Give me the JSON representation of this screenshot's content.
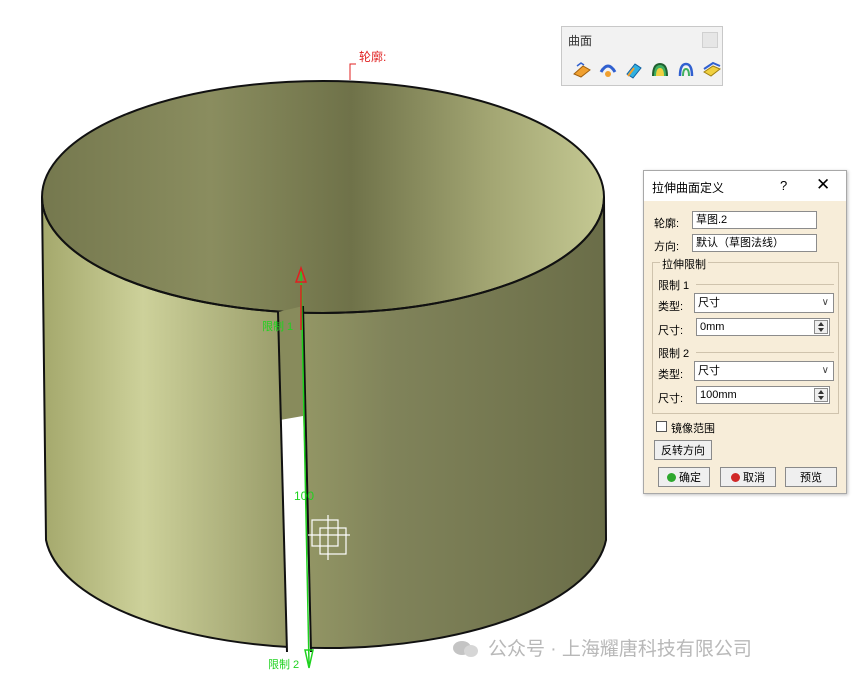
{
  "viewport": {
    "profile_label": "轮廓:",
    "limit1_label": "限制 1",
    "limit2_label": "限制 2",
    "dimension_label": "100"
  },
  "toolbar": {
    "title": "曲面",
    "icons": [
      "extrude-surface-icon",
      "revolve-surface-icon",
      "sphere-surface-icon",
      "cylinder-surface-icon",
      "offset-surface-icon",
      "fill-surface-icon"
    ]
  },
  "dialog": {
    "title": "拉伸曲面定义",
    "help": "?",
    "close": "✕",
    "profile_label": "轮廓:",
    "profile_value": "草图.2",
    "direction_label": "方向:",
    "direction_value": "默认（草图法线）",
    "extent_group": "拉伸限制",
    "limit1": {
      "title": "限制 1",
      "type_label": "类型:",
      "type_value": "尺寸",
      "dim_label": "尺寸:",
      "dim_value": "0mm"
    },
    "limit2": {
      "title": "限制 2",
      "type_label": "类型:",
      "type_value": "尺寸",
      "dim_label": "尺寸:",
      "dim_value": "100mm"
    },
    "mirror_label": "镜像范围",
    "reverse_label": "反转方向",
    "ok_label": "确定",
    "cancel_label": "取消",
    "preview_label": "预览"
  },
  "watermark": "公众号 · 上海耀唐科技有限公司",
  "colors": {
    "surface_light": "#c8cc94",
    "surface_dark": "#7a7d55",
    "axis_green": "#1fd21f",
    "axis_red": "#e02020",
    "dialog_bg": "#f7edd9"
  }
}
